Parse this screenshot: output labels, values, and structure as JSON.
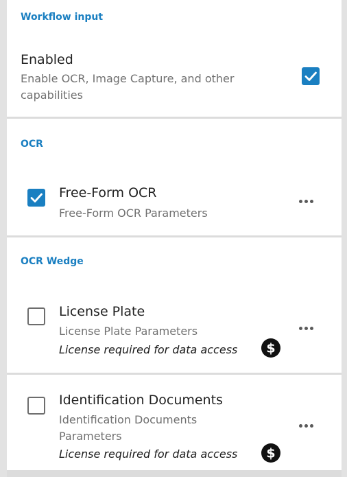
{
  "sections": {
    "workflow_input": {
      "title": "Workflow input",
      "enabled_label": "Enabled",
      "enabled_description": "Enable OCR, Image Capture, and other capabilities",
      "enabled_checked": true
    },
    "ocr": {
      "title": "OCR",
      "items": [
        {
          "title": "Free-Form OCR",
          "subtitle": "Free-Form OCR Parameters",
          "checked": true
        }
      ]
    },
    "ocr_wedge": {
      "title": "OCR Wedge",
      "items": [
        {
          "title": "License Plate",
          "subtitle": "License Plate Parameters",
          "license_note": "License required for data access",
          "checked": false
        },
        {
          "title": "Identification Documents",
          "subtitle": "Identification Documents Parameters",
          "license_note": "License required for data access",
          "checked": false
        }
      ]
    }
  },
  "icons": {
    "more": "more-horizontal-icon",
    "license": "dollar-circle-icon",
    "check": "check-icon"
  },
  "colors": {
    "accent": "#1a7fc1",
    "divider": "#dcdcdc",
    "checkbox_border": "#6d6d6d"
  }
}
